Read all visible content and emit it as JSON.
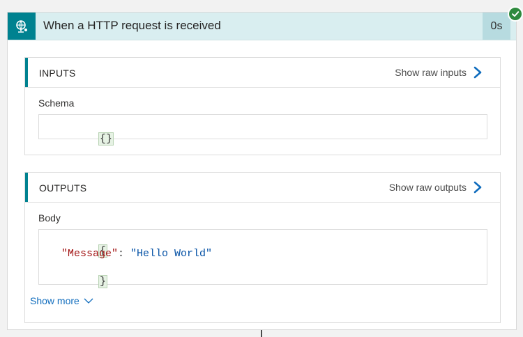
{
  "trigger": {
    "title": "When a HTTP request is received",
    "duration": "0s",
    "status": "succeeded",
    "icon": "http-request-icon",
    "colors": {
      "accent": "#008290",
      "header_bg": "#d9eef0",
      "success": "#2e8a3e"
    }
  },
  "inputs": {
    "title": "INPUTS",
    "raw_link": "Show raw inputs",
    "field_label": "Schema",
    "value": "{}"
  },
  "outputs": {
    "title": "OUTPUTS",
    "raw_link": "Show raw outputs",
    "field_label": "Body",
    "open_brace": "{",
    "key": "\"Message\"",
    "colon": ": ",
    "value": "\"Hello World\"",
    "close_brace": "}"
  },
  "show_more": {
    "label": "Show more",
    "icon": "chevron-down-icon"
  }
}
